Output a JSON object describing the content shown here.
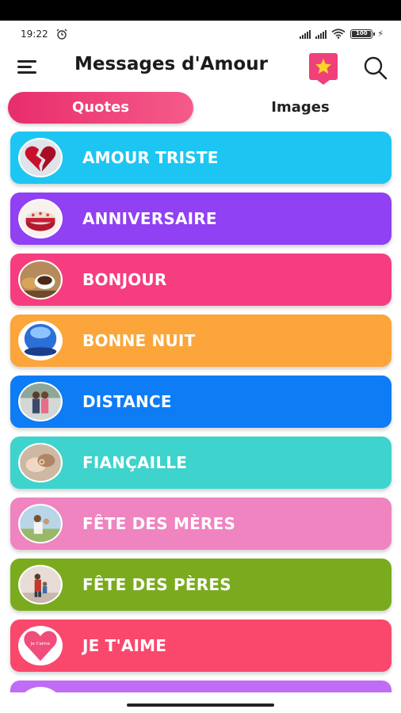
{
  "status_bar": {
    "time": "19:22",
    "battery": "100"
  },
  "app_bar": {
    "title": "Messages d'Amour",
    "menu_icon": "hamburger-menu-icon",
    "favorites_icon": "star-bookmark-icon",
    "search_icon": "search-icon",
    "accent_color": "#f0407a"
  },
  "tabs": [
    {
      "label": "Quotes",
      "selected": true
    },
    {
      "label": "Images",
      "selected": false
    }
  ],
  "categories": [
    {
      "label": "AMOUR TRISTE",
      "color": "#1dc6f2",
      "icon": "broken-heart-icon"
    },
    {
      "label": "ANNIVERSAIRE",
      "color": "#8f41f3",
      "icon": "cake-icon"
    },
    {
      "label": "BONJOUR",
      "color": "#f63d7f",
      "icon": "coffee-cup-icon"
    },
    {
      "label": "BONNE NUIT",
      "color": "#fba53a",
      "icon": "moon-icon"
    },
    {
      "label": "DISTANCE",
      "color": "#0d7cf5",
      "icon": "couple-photo-icon"
    },
    {
      "label": "FIANÇAILLE",
      "color": "#3fd3cd",
      "icon": "ring-photo-icon"
    },
    {
      "label": "FÊTE DES MÈRES",
      "color": "#ef84c0",
      "icon": "mother-photo-icon"
    },
    {
      "label": "FÊTE DES PÈRES",
      "color": "#7aab1f",
      "icon": "father-photo-icon"
    },
    {
      "label": "JE T'AIME",
      "color": "#f9486c",
      "icon": "heart-je-taime-icon",
      "icon_text": "Je t'aime"
    },
    {
      "label": "",
      "color": "#c06cf5",
      "icon": "partial-item-icon"
    }
  ]
}
